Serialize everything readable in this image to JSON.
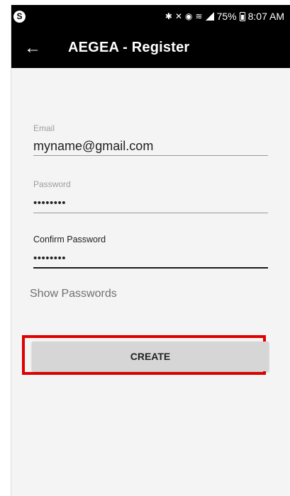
{
  "status_bar": {
    "left_icon": "skype-icon",
    "left_icon_glyph": "S",
    "right_icons": [
      "bluetooth-icon",
      "mute-icon",
      "alarm-icon",
      "wifi-icon",
      "signal-icon",
      "battery-icon"
    ],
    "battery_percent": "75%",
    "time": "8:07 AM"
  },
  "app_bar": {
    "back_icon": "arrow-left-icon",
    "title": "AEGEA - Register"
  },
  "form": {
    "email": {
      "label": "Email",
      "value": "myname@gmail.com"
    },
    "password": {
      "label": "Password",
      "value": "••••••••"
    },
    "confirm_password": {
      "label": "Confirm Password",
      "value": "••••••••"
    },
    "show_passwords_label": "Show Passwords",
    "create_button_label": "CREATE"
  },
  "colors": {
    "app_bar_bg": "#000000",
    "screen_bg": "#f4f4f4",
    "button_bg": "#d6d6d6",
    "highlight_border": "#e00000"
  }
}
